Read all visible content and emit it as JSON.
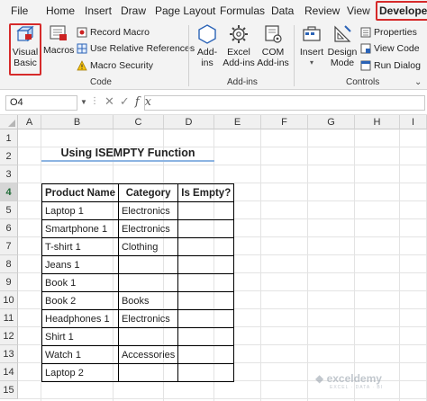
{
  "menu": {
    "tabs": [
      "File",
      "Home",
      "Insert",
      "Draw",
      "Page Layout",
      "Formulas",
      "Data",
      "Review",
      "View",
      "Developer"
    ],
    "active_tab": "Developer"
  },
  "ribbon": {
    "code": {
      "label": "Code",
      "visual_basic_line1": "Visual",
      "visual_basic_line2": "Basic",
      "macros": "Macros",
      "record_macro": "Record Macro",
      "relative_refs": "Use Relative References",
      "macro_security": "Macro Security"
    },
    "addins": {
      "label": "Add-ins",
      "addins_line1": "Add-",
      "addins_line2": "ins",
      "excel_addins_line1": "Excel",
      "excel_addins_line2": "Add-ins",
      "com_addins_line1": "COM",
      "com_addins_line2": "Add-ins"
    },
    "controls": {
      "label": "Controls",
      "insert": "Insert",
      "design_mode_line1": "Design",
      "design_mode_line2": "Mode",
      "properties": "Properties",
      "view_code": "View Code",
      "run_dialog": "Run Dialog"
    }
  },
  "formula_bar": {
    "name_box": "O4",
    "formula": ""
  },
  "sheet": {
    "columns": [
      "A",
      "B",
      "C",
      "D",
      "E",
      "F",
      "G",
      "H",
      "I"
    ],
    "rows": [
      "1",
      "2",
      "3",
      "4",
      "5",
      "6",
      "7",
      "8",
      "9",
      "10",
      "11",
      "12",
      "13",
      "14",
      "15"
    ],
    "selected_row": "4",
    "title": "Using ISEMPTY Function",
    "table": {
      "headers": [
        "Product Name",
        "Category",
        "Is Empty?"
      ],
      "rows": [
        [
          "Laptop 1",
          "Electronics",
          ""
        ],
        [
          "Smartphone 1",
          "Electronics",
          ""
        ],
        [
          "T-shirt 1",
          "Clothing",
          ""
        ],
        [
          "Jeans 1",
          "",
          ""
        ],
        [
          "Book 1",
          "",
          ""
        ],
        [
          "Book 2",
          "Books",
          ""
        ],
        [
          "Headphones 1",
          "Electronics",
          ""
        ],
        [
          "Shirt 1",
          "",
          ""
        ],
        [
          "Watch 1",
          "Accessories",
          ""
        ],
        [
          "Laptop 2",
          "",
          ""
        ]
      ]
    }
  },
  "watermark": {
    "brand": "exceldemy",
    "tagline": "EXCEL · DATA · BI"
  }
}
